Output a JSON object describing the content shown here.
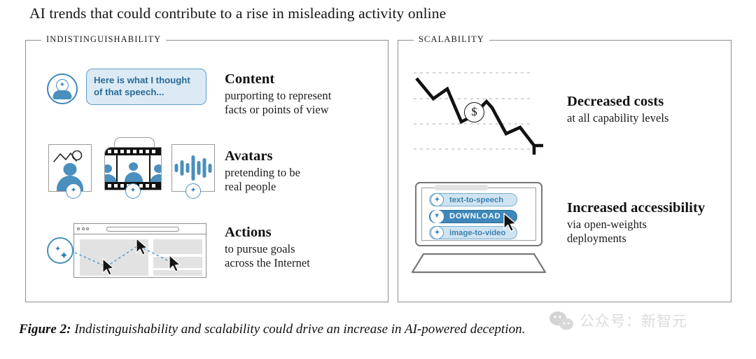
{
  "figure": {
    "title": "AI trends that could contribute to a rise in misleading activity online",
    "caption_label": "Figure 2:",
    "caption_text": "Indistinguishability and scalability could drive an increase in AI-powered deception."
  },
  "colors": {
    "accent_blue": "#4a8fbd",
    "accent_blue_dark": "#3d87ba",
    "bubble_fill": "#dbeaf5",
    "bubble_border": "#5c9ec9",
    "pill_light_fill": "#cfe3f1",
    "panel_border": "#8d8d8d",
    "placeholder_gray": "#e2e2e2",
    "text": "#161616"
  },
  "panels": [
    {
      "id": "indistinguishability",
      "label": "INDISTINGUISHABILITY",
      "rows": [
        {
          "id": "content",
          "heading": "Content",
          "subtext": "purporting to represent\nfacts or points of view",
          "art": {
            "type": "avatar-speech-bubble",
            "avatar_icon": "ai-person-icon",
            "bubble_text": "Here is what I thought of that speech..."
          }
        },
        {
          "id": "avatars",
          "heading": "Avatars",
          "subtext": "pretending to be\nreal people",
          "art": {
            "type": "media-cards",
            "cards": [
              "photo-icon",
              "film-strip-icon",
              "audio-waveform-icon"
            ],
            "badge_icon": "sparkle-icon"
          }
        },
        {
          "id": "actions",
          "heading": "Actions",
          "subtext": "to pursue goals\nacross the Internet",
          "art": {
            "type": "browser-agent-path",
            "agent_icon": "sparkle-icon",
            "cursor_icon": "mouse-cursor-icon",
            "cursor_count": 3
          }
        }
      ]
    },
    {
      "id": "scalability",
      "label": "SCALABILITY",
      "rows": [
        {
          "id": "decreased-costs",
          "heading": "Decreased costs",
          "subtext": "at all capability levels",
          "art": {
            "type": "downward-trend-arrow",
            "badge_label": "$",
            "gridlines": 4
          }
        },
        {
          "id": "increased-accessibility",
          "heading": "Increased accessibility",
          "subtext": "via open-weights\ndeployments",
          "art": {
            "type": "laptop-download-menu",
            "items": [
              {
                "label": "text-to-speech",
                "style": "light",
                "icon": "sparkle-icon"
              },
              {
                "label": "DOWNLOAD",
                "style": "dark",
                "icon": "download-arrow-icon"
              },
              {
                "label": "image-to-video",
                "style": "light",
                "icon": "sparkle-icon"
              }
            ],
            "cursor_icon": "mouse-cursor-icon"
          }
        }
      ]
    }
  ],
  "watermark": {
    "text": "公众号：新智元",
    "icon": "wechat-icon"
  }
}
